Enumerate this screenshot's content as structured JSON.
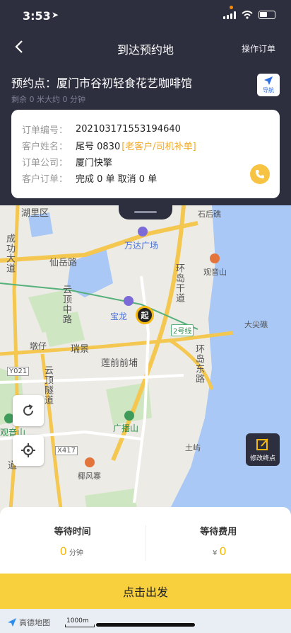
{
  "status_bar": {
    "time": "3:53",
    "location_arrow": "➤"
  },
  "nav": {
    "title": "到达预约地",
    "action_label": "操作订单"
  },
  "destination": {
    "label": "预约点：厦门市谷初轻食花艺咖啡馆",
    "sub": "剩余 0 米大约 0 分钟",
    "nav_button_label": "导航"
  },
  "order": {
    "rows": [
      {
        "key": "订单编号：",
        "value": "20210317155319464​0",
        "tag": ""
      },
      {
        "key": "客户姓名：",
        "value": "尾号 0830",
        "tag": "[老客户/司机补单]"
      },
      {
        "key": "订单公司：",
        "value": "厦门快擎",
        "tag": ""
      },
      {
        "key": "客户订单：",
        "value": "完成 0 单  取消 0 单",
        "tag": ""
      }
    ]
  },
  "map": {
    "labels": {
      "huli": "湖里区",
      "shigu": "石后礁",
      "chenggong": "成功大道",
      "wanda": "万达广场",
      "xianyue": "仙岳路",
      "guanyinshan": "观音山",
      "huandao_qian": "环岛干道",
      "yunding_zhong": "云顶中路",
      "baolong": "宝龙",
      "hao2": "2号线",
      "dajian": "大尖礁",
      "dunzi": "墩仔",
      "ruijing": "瑞景",
      "lianqian": "莲前前埔",
      "huandao_nan": "环岛东路",
      "y021": "Y021",
      "yunding_sui": "云顶隧道",
      "guanyinshan2": "观音山",
      "guangboshan": "广播山",
      "tuyu": "土屿",
      "x417": "X417",
      "yefeng": "椰风寨",
      "dao": "道",
      "start_pin": "起"
    },
    "edit_end_label": "修改终点"
  },
  "stats": {
    "wait_time_title": "等待时间",
    "wait_time_value": "0",
    "wait_time_unit": "分钟",
    "wait_fee_title": "等待费用",
    "wait_fee_currency": "¥",
    "wait_fee_value": "0"
  },
  "go_button": "点击出发",
  "footer": {
    "amap_label": "高德地图",
    "scale_label": "1000m"
  },
  "colors": {
    "header": "#2d2f3e",
    "accent": "#f8cf3c",
    "call": "#f6c342"
  }
}
